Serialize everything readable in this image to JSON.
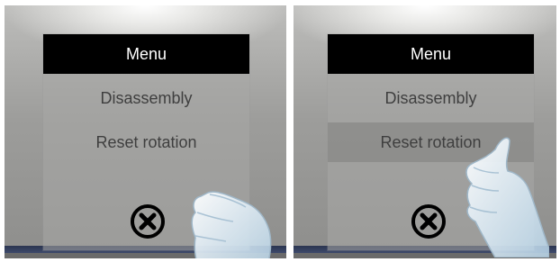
{
  "screens": [
    {
      "menu": {
        "title": "Menu",
        "items": [
          {
            "label": "Disassembly"
          },
          {
            "label": "Reset rotation"
          }
        ],
        "close_icon": "close-circle-icon"
      },
      "hovered_item": null
    },
    {
      "menu": {
        "title": "Menu",
        "items": [
          {
            "label": "Disassembly"
          },
          {
            "label": "Reset rotation"
          }
        ],
        "close_icon": "close-circle-icon"
      },
      "hovered_item": "Reset rotation"
    }
  ],
  "colors": {
    "header_bg": "#000000",
    "header_text": "#ffffff",
    "item_text": "#3f3f3f",
    "hover_bg": "#7a7a78"
  }
}
